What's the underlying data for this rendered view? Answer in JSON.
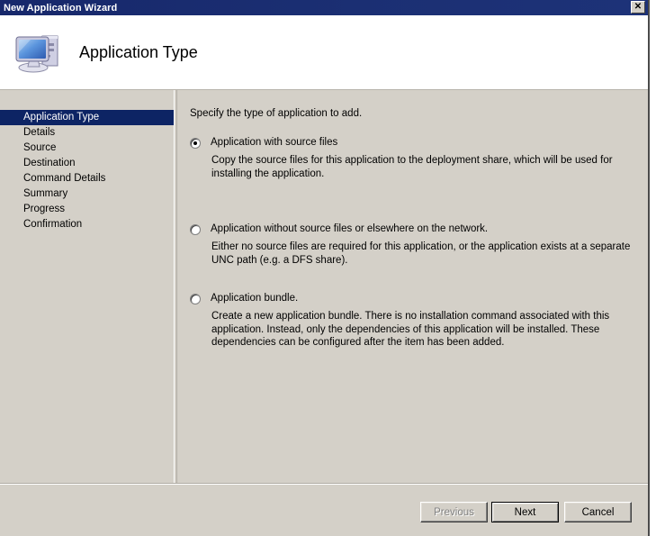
{
  "window": {
    "title": "New Application Wizard",
    "close_label": "✕"
  },
  "header": {
    "title": "Application Type",
    "icon": "computer-monitor-icon"
  },
  "sidebar": {
    "items": [
      {
        "label": "Application Type",
        "selected": true
      },
      {
        "label": "Details",
        "selected": false
      },
      {
        "label": "Source",
        "selected": false
      },
      {
        "label": "Destination",
        "selected": false
      },
      {
        "label": "Command Details",
        "selected": false
      },
      {
        "label": "Summary",
        "selected": false
      },
      {
        "label": "Progress",
        "selected": false
      },
      {
        "label": "Confirmation",
        "selected": false
      }
    ]
  },
  "content": {
    "intro": "Specify the type of application to add.",
    "options": [
      {
        "label": "Application with source files",
        "description": "Copy the source files for this application to the deployment share, which will be used for installing the application.",
        "selected": true
      },
      {
        "label": "Application without source files or elsewhere on the network.",
        "description": "Either no source files are required for this application, or the application exists at a separate UNC path (e.g. a DFS share).",
        "selected": false
      },
      {
        "label": "Application bundle.",
        "description": "Create a new application bundle.  There is no installation command associated with this application.  Instead, only the dependencies of this application will be installed.  These dependencies can be configured after the item has been added.",
        "selected": false
      }
    ]
  },
  "footer": {
    "previous_label": "Previous",
    "previous_disabled": true,
    "next_label": "Next",
    "next_default": true,
    "cancel_label": "Cancel"
  },
  "colors": {
    "titlebar": "#1b2f6b",
    "selection": "#0d2464",
    "face": "#d4d0c8"
  }
}
